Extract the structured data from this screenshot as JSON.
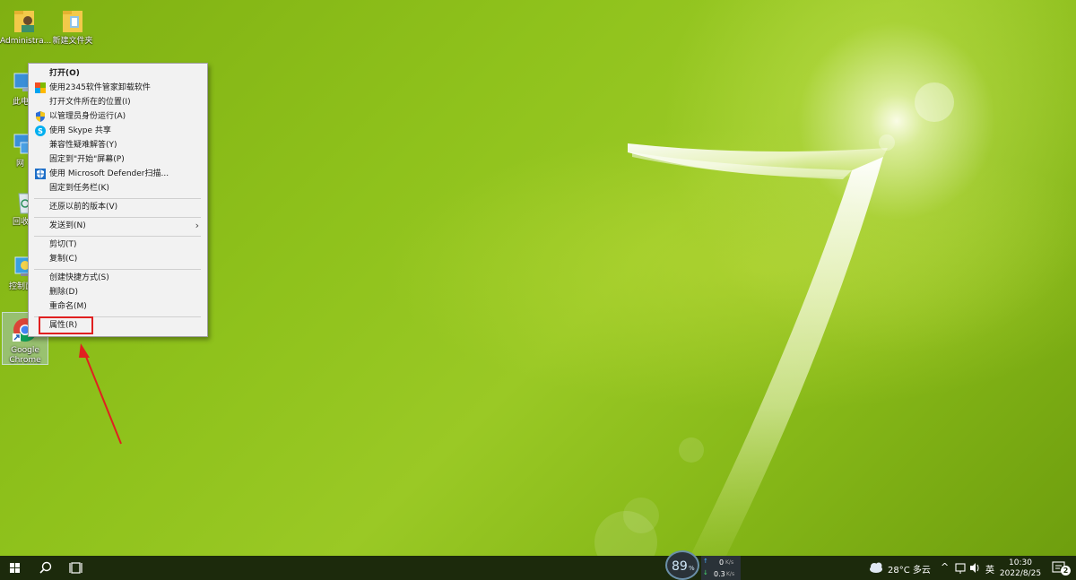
{
  "desktop": {
    "icons": [
      {
        "label": "Administra..."
      },
      {
        "label": "新建文件夹"
      },
      {
        "label": "此电"
      },
      {
        "label": "网"
      },
      {
        "label": "回收"
      },
      {
        "label": "控制面"
      },
      {
        "label": "Google Chrome"
      }
    ]
  },
  "context_menu": {
    "items": [
      {
        "label": "打开(O)",
        "icon": "none"
      },
      {
        "label": "使用2345软件管家卸载软件",
        "icon": "2345-manager-icon"
      },
      {
        "label": "打开文件所在的位置(I)",
        "icon": "none"
      },
      {
        "label": "以管理员身份运行(A)",
        "icon": "uac-shield-icon"
      },
      {
        "label": "使用 Skype 共享",
        "icon": "skype-icon"
      },
      {
        "label": "兼容性疑难解答(Y)",
        "icon": "none"
      },
      {
        "label": "固定到\"开始\"屏幕(P)",
        "icon": "none"
      },
      {
        "label": "使用 Microsoft Defender扫描...",
        "icon": "defender-icon"
      },
      {
        "label": "固定到任务栏(K)",
        "icon": "none"
      },
      {
        "label": "还原以前的版本(V)",
        "icon": "none"
      },
      {
        "label": "发送到(N)",
        "icon": "none"
      },
      {
        "label": "剪切(T)",
        "icon": "none"
      },
      {
        "label": "复制(C)",
        "icon": "none"
      },
      {
        "label": "创建快捷方式(S)",
        "icon": "none"
      },
      {
        "label": "删除(D)",
        "icon": "none"
      },
      {
        "label": "重命名(M)",
        "icon": "none"
      },
      {
        "label": "属性(R)",
        "icon": "none"
      }
    ],
    "submenu_arrow": "›"
  },
  "annotation": {
    "highlight_color": "#e02020"
  },
  "taskbar": {
    "speed_percent": "89",
    "speed_unit": "%",
    "upload_value": "0",
    "upload_unit": "K/s",
    "download_value": "0.3",
    "download_unit": "K/s",
    "weather": "28°C 多云",
    "ime": "英",
    "time": "10:30",
    "date": "2022/8/25",
    "notification_count": "2"
  },
  "colors": {
    "wallpaper_green": "#8dbb1a",
    "taskbar_bg": "#1c2a0c",
    "menu_bg": "#f2f2f2"
  }
}
